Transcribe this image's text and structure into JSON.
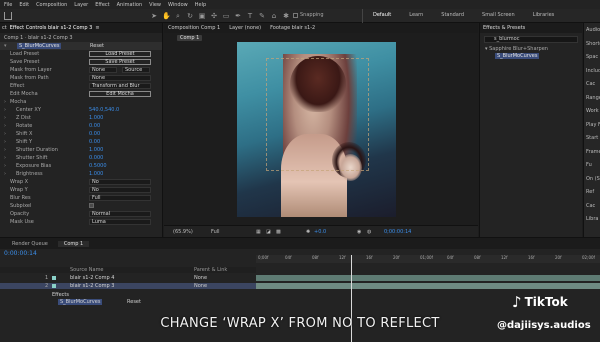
{
  "menu": [
    "File",
    "Edit",
    "Composition",
    "Layer",
    "Effect",
    "Animation",
    "View",
    "Window",
    "Help"
  ],
  "toolbar": {
    "snapping": "Snapping",
    "workspaces": [
      "Default",
      "Learn",
      "Standard",
      "Small Screen",
      "Libraries"
    ]
  },
  "left_panel": {
    "tabs": [
      "ct",
      "Effect Controls blair s1-2 Comp 3",
      "≡"
    ],
    "crumb": "Comp 1 · blair s1-2 Comp 3",
    "effect_name": "S_BlurMoCurves",
    "reset": "Reset",
    "rows": [
      {
        "label": "Load Preset",
        "button": "Load Preset"
      },
      {
        "label": "Save Preset",
        "button": "Save Preset"
      },
      {
        "label": "Mask from Layer",
        "select": "None",
        "select2": "Source"
      },
      {
        "label": "Mask from Path",
        "select": "None"
      },
      {
        "label": "Effect",
        "select": "Transform and Blur"
      },
      {
        "label": "Edit Mocha",
        "button": "Edit Mocha"
      },
      {
        "label": "Mocha"
      },
      {
        "label": "Center XY",
        "value": "540.0,540.0"
      },
      {
        "label": "Z Dist",
        "value": "1.000"
      },
      {
        "label": "Rotate",
        "value": "0.00"
      },
      {
        "label": "Shift X",
        "value": "0.00"
      },
      {
        "label": "Shift Y",
        "value": "0.00"
      },
      {
        "label": "Shutter Duration",
        "value": "1.000"
      },
      {
        "label": "Shutter Shift",
        "value": "0.000"
      },
      {
        "label": "Exposure Bias",
        "value": "0.5000"
      },
      {
        "label": "Brightness",
        "value": "1.000"
      },
      {
        "label": "Wrap X",
        "select": "No"
      },
      {
        "label": "Wrap Y",
        "select": "No"
      },
      {
        "label": "Blur Res",
        "select": "Full"
      },
      {
        "label": "Subpixel"
      },
      {
        "label": "Opacity",
        "select": "Normal"
      },
      {
        "label": "Mask Use",
        "select": "Luma"
      }
    ]
  },
  "comp_panel": {
    "tabs": [
      "Composition Comp 1",
      "Layer (none)",
      "Footage blair s1-2"
    ],
    "sub": "Comp 1",
    "zoom": "(65.9%)",
    "resolution": "Full",
    "exposure": "+0.0",
    "timecode": "0;00:00:14"
  },
  "right_panel": {
    "title": "Effects & Presets",
    "search": "s_blurmoc",
    "group": "Sapphire Blur+Sharpen",
    "item": "S_BlurMoCurves"
  },
  "far_right": [
    "Audio",
    "Shortcut",
    "Spac",
    "Includ",
    "Cac",
    "Range",
    "Work",
    "Play Fr",
    "Start",
    "Frame",
    "Fu",
    "On (Sp",
    "Ref",
    "Cac",
    "Libra"
  ],
  "timeline": {
    "tabs": [
      "Render Queue",
      "Comp 1"
    ],
    "timecode": "0:00:00:14",
    "columns": {
      "source": "Source Name",
      "parent": "Parent & Link"
    },
    "layers": [
      {
        "num": "1",
        "name": "blair s1-2 Comp 4",
        "parent": "None"
      },
      {
        "num": "2",
        "name": "blair s1-2 Comp 3",
        "parent": "None"
      }
    ],
    "effects_label": "Effects",
    "effect_row": "S_BlurMoCurves",
    "effect_reset": "Reset",
    "ruler": [
      "0;00f",
      "04f",
      "08f",
      "12f",
      "16f",
      "20f",
      "01;00f",
      "04f",
      "08f",
      "12f",
      "16f",
      "20f",
      "02;00f"
    ]
  },
  "caption": "CHANGE ‘WRAP X’ FROM NO TO REFLECT",
  "watermark": {
    "brand": "TikTok",
    "handle": "@dajiisys.audios"
  }
}
